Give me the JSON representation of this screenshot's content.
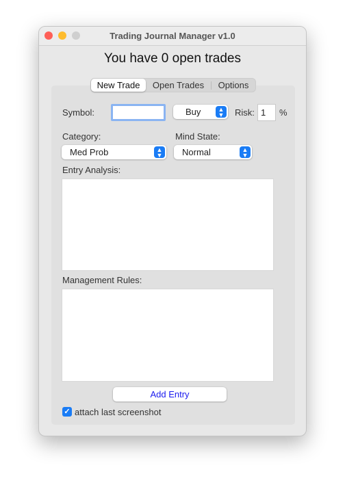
{
  "window": {
    "title": "Trading Journal Manager v1.0"
  },
  "heading": "You have 0 open trades",
  "tabs": [
    {
      "label": "New Trade",
      "selected": true
    },
    {
      "label": "Open Trades"
    },
    {
      "label": "Options"
    }
  ],
  "form": {
    "symbol_label": "Symbol:",
    "symbol_value": "",
    "direction": "Buy",
    "risk_label": "Risk:",
    "risk_value": "1",
    "risk_unit": "%",
    "category_label": "Category:",
    "category_value": "Med Prob",
    "mind_label": "Mind State:",
    "mind_value": "Normal",
    "entry_label": "Entry Analysis:",
    "entry_value": "",
    "rules_label": "Management Rules:",
    "rules_value": "",
    "add_button": "Add Entry",
    "attach_label": "attach last screenshot",
    "attach_checked": true
  },
  "colors": {
    "accent": "#1a7cf5",
    "button_text": "#1a1aee"
  }
}
